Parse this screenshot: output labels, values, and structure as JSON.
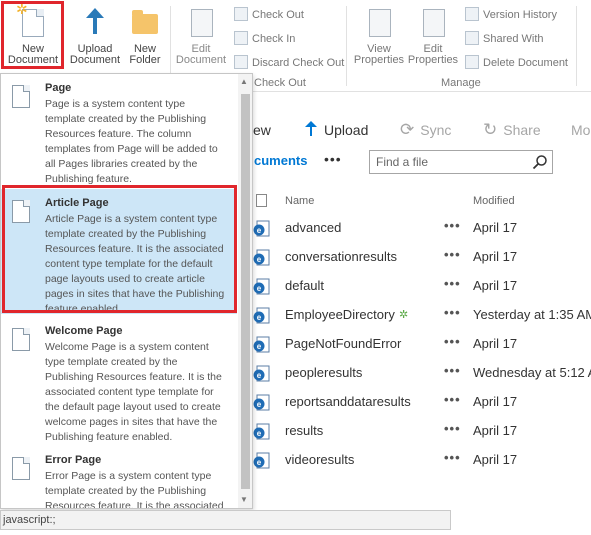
{
  "ribbon": {
    "new_document": "New\nDocument",
    "upload_document": "Upload\nDocument",
    "new_folder": "New\nFolder",
    "edit_document": "Edit\nDocument",
    "check_out": "Check Out",
    "check_in": "Check In",
    "discard_check_out": "Discard Check Out",
    "view_properties": "View\nProperties",
    "edit_properties": "Edit\nProperties",
    "version_history": "Version History",
    "shared_with": "Shared With",
    "delete_document": "Delete Document",
    "group_open_check_out": "Check Out",
    "group_manage": "Manage"
  },
  "commands": {
    "new": "ew",
    "upload": "Upload",
    "sync": "Sync",
    "share": "Share",
    "more": "Mo"
  },
  "library": {
    "tab": "cuments",
    "more": "•••",
    "search_placeholder": "Find a file",
    "col_name": "Name",
    "col_modified": "Modified",
    "rows": [
      {
        "name": "advanced",
        "modified": "April 17",
        "new": false
      },
      {
        "name": "conversationresults",
        "modified": "April 17",
        "new": false
      },
      {
        "name": "default",
        "modified": "April 17",
        "new": false
      },
      {
        "name": "EmployeeDirectory",
        "modified": "Yesterday at 1:35 AM",
        "new": true
      },
      {
        "name": "PageNotFoundError",
        "modified": "April 17",
        "new": false
      },
      {
        "name": "peopleresults",
        "modified": "Wednesday at 5:12 A",
        "new": false
      },
      {
        "name": "reportsanddataresults",
        "modified": "April 17",
        "new": false
      },
      {
        "name": "results",
        "modified": "April 17",
        "new": false
      },
      {
        "name": "videoresults",
        "modified": "April 17",
        "new": false
      }
    ],
    "row_dots": "•••",
    "new_mark": "✲"
  },
  "dropdown": {
    "items": [
      {
        "title": "Page",
        "desc": "Page is a system content type template created by the Publishing Resources feature. The column templates from Page will be added to all Pages libraries created by the Publishing feature."
      },
      {
        "title": "Article Page",
        "desc": "Article Page is a system content type template created by the Publishing Resources feature. It is the associated content type template for the default page layouts used to create article pages in sites that have the Publishing feature enabled."
      },
      {
        "title": "Welcome Page",
        "desc": "Welcome Page is a system content type template created by the Publishing Resources feature. It is the associated content type template for the default page layout used to create welcome pages in sites that have the Publishing feature enabled."
      },
      {
        "title": "Error Page",
        "desc": "Error Page is a system content type template created by the Publishing Resources feature. It is the associated"
      }
    ]
  },
  "status": {
    "text": "javascript:;"
  },
  "colors": {
    "accent": "#0078d4",
    "highlight_border": "#e0262c",
    "selected_bg": "#cde6f7"
  }
}
